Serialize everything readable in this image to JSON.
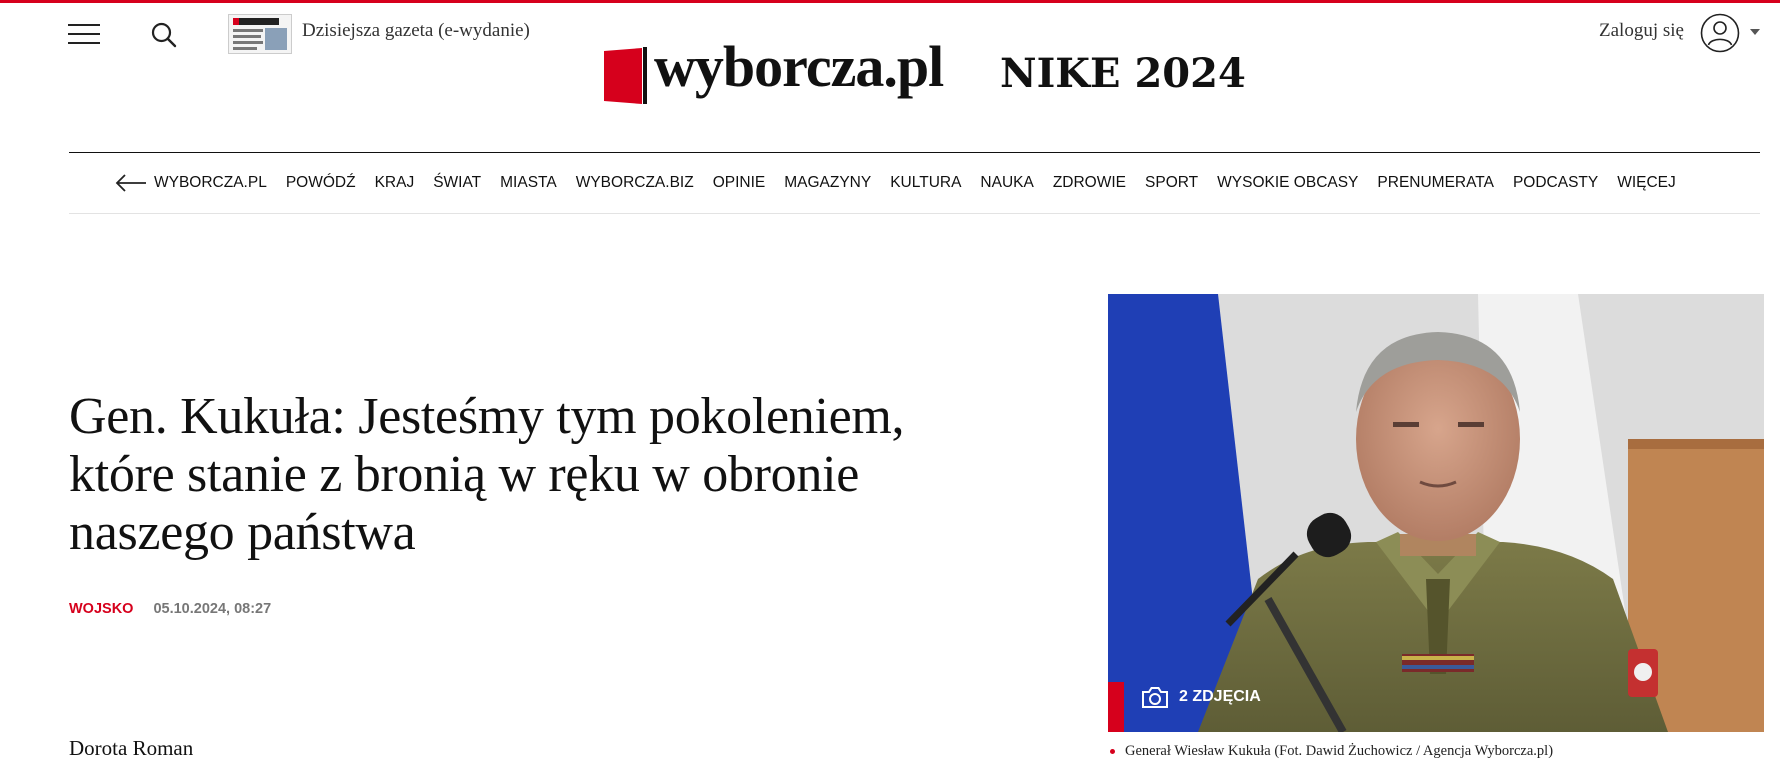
{
  "header": {
    "menu_icon": "hamburger-icon",
    "search_icon": "search-icon",
    "edition_link": "Dzisiejsza gazeta (e-wydanie)",
    "login_label": "Zaloguj się",
    "user_icon": "user-icon",
    "logo_text": "wyborcza.pl",
    "campaign_text": "NIKE 2024",
    "accent_color": "#d6001c"
  },
  "nav": {
    "back_icon": "arrow-left-icon",
    "items": [
      "WYBORCZA.PL",
      "POWÓDŹ",
      "KRAJ",
      "ŚWIAT",
      "MIASTA",
      "WYBORCZA.BIZ",
      "OPINIE",
      "MAGAZYNY",
      "KULTURA",
      "NAUKA",
      "ZDROWIE",
      "SPORT",
      "WYSOKIE OBCASY",
      "PRENUMERATA",
      "PODCASTY",
      "WIĘCEJ"
    ]
  },
  "article": {
    "headline": "Gen. Kukuła: Jesteśmy tym pokoleniem, które stanie z bronią w ręku w obronie naszego państwa",
    "category": "WOJSKO",
    "date": "05.10.2024, 08:27",
    "author": "Dorota Roman"
  },
  "photo": {
    "gallery_label": "2 ZDJĘCIA",
    "camera_icon": "camera-icon",
    "caption": "Generał Wiesław Kukuła (Fot. Dawid Żuchowicz / Agencja Wyborcza.pl)"
  }
}
